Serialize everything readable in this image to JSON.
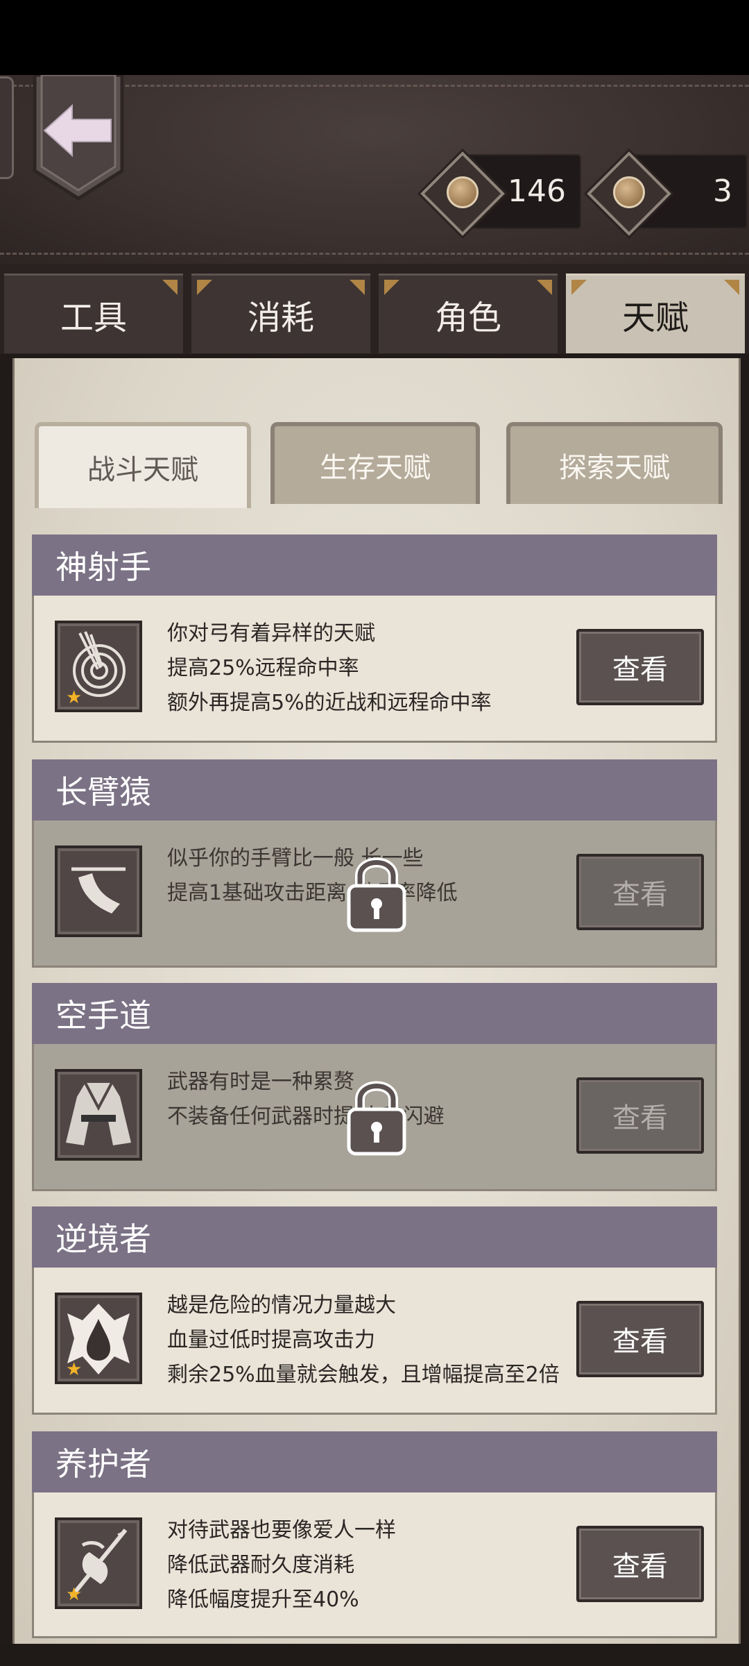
{
  "currencies": [
    {
      "icon": "coin-icon",
      "value": "146"
    },
    {
      "icon": "gem-coin-icon",
      "value": "3"
    }
  ],
  "category_tabs": [
    {
      "label": "工具"
    },
    {
      "label": "消耗"
    },
    {
      "label": "角色"
    },
    {
      "label": "天赋",
      "active": true
    }
  ],
  "sub_tabs": [
    {
      "label": "战斗天赋",
      "active": true
    },
    {
      "label": "生存天赋"
    },
    {
      "label": "探索天赋"
    }
  ],
  "talents": [
    {
      "name": "神射手",
      "icon": "target-arrows-icon",
      "star": true,
      "locked": false,
      "lines": [
        "你对弓有着异样的天赋",
        "提高25%远程命中率",
        "额外再提高5%的近战和远程命中率"
      ],
      "button": "查看"
    },
    {
      "name": "长臂猿",
      "icon": "long-arm-icon",
      "star": false,
      "locked": true,
      "lines": [
        "似乎你的手臂比一般    长一些",
        "提高1基础攻击距离    避几率降低"
      ],
      "button": "查看"
    },
    {
      "name": "空手道",
      "icon": "karate-gi-icon",
      "star": false,
      "locked": true,
      "lines": [
        "武器有时是一种累赘",
        "不装备任何武器时提    击和闪避"
      ],
      "button": "查看"
    },
    {
      "name": "逆境者",
      "icon": "blood-drop-icon",
      "star": true,
      "locked": false,
      "lines": [
        "越是危险的情况力量越大",
        "血量过低时提高攻击力",
        "剩余25%血量就会触发，且增幅提高至2倍"
      ],
      "button": "查看"
    },
    {
      "name": "养护者",
      "icon": "weapon-care-icon",
      "star": true,
      "locked": false,
      "lines": [
        "对待武器也要像爱人一样",
        "降低武器耐久度消耗",
        "降低幅度提升至40%"
      ],
      "button": "查看"
    }
  ]
}
